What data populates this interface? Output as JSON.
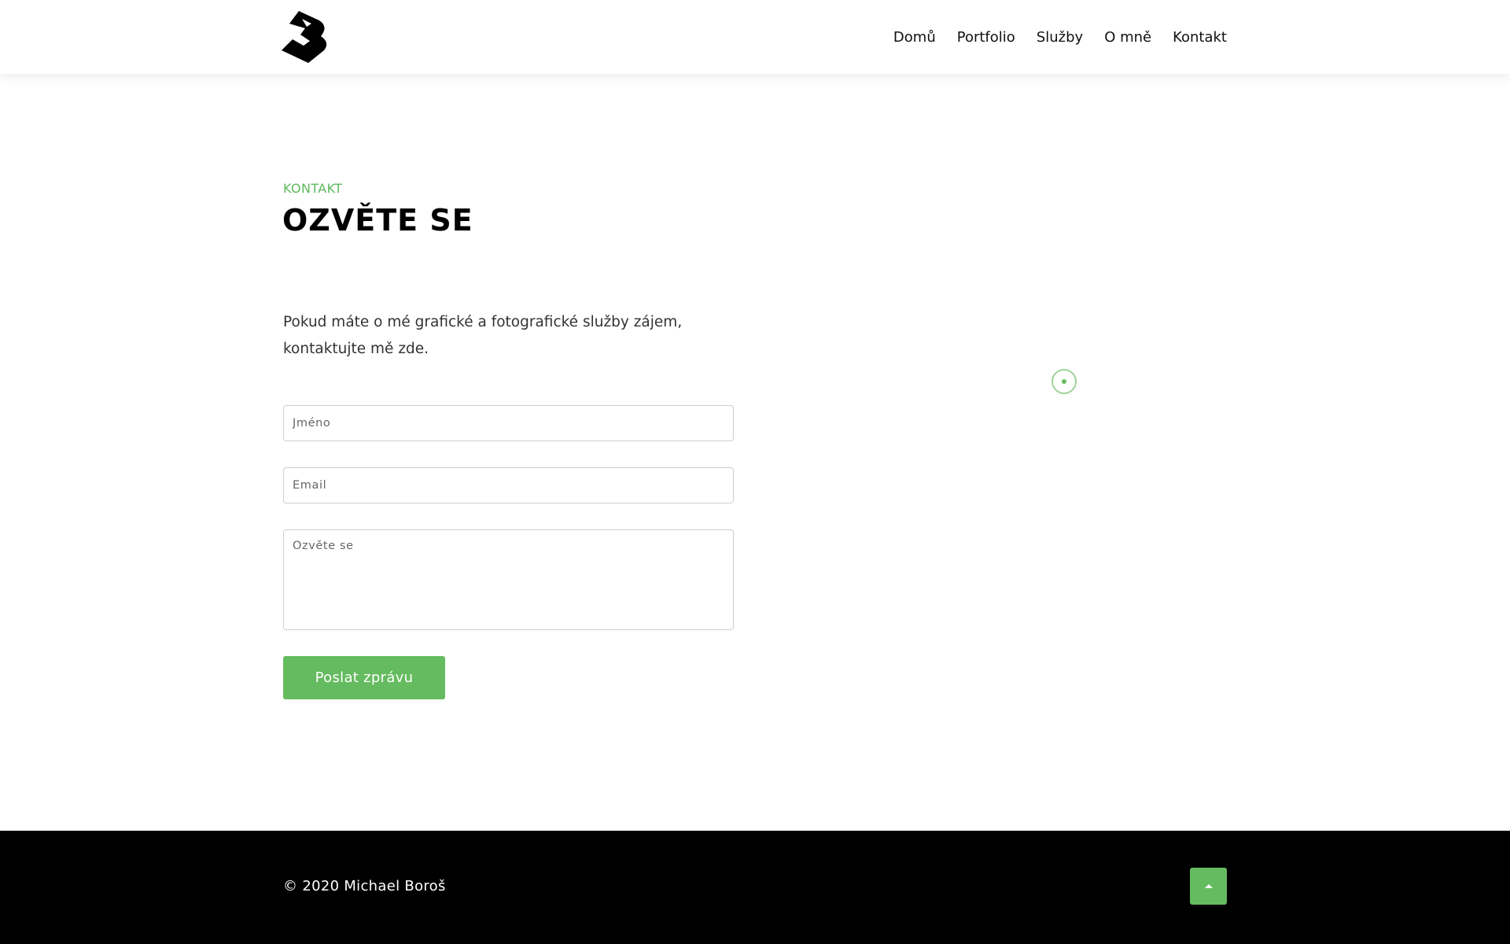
{
  "nav": {
    "items": [
      "Domů",
      "Portfolio",
      "Služby",
      "O mně",
      "Kontakt"
    ]
  },
  "contact": {
    "section_label": "KONTAKT",
    "title": "OZVĚTE SE",
    "intro": "Pokud máte o mé grafické a fotografické služby zájem, kontaktujte mě zde."
  },
  "form": {
    "name_placeholder": "Jméno",
    "email_placeholder": "Email",
    "message_placeholder": "Ozvěte se",
    "submit_label": "Poslat zprávu"
  },
  "footer": {
    "copyright": "© 2020 Michael Boroš"
  },
  "icons": {
    "logo": "logo-icon",
    "loader": "loading-spinner-icon",
    "back_to_top": "caret-up-icon"
  },
  "colors": {
    "accent": "#65bb5f",
    "footer_bg": "#000000"
  }
}
